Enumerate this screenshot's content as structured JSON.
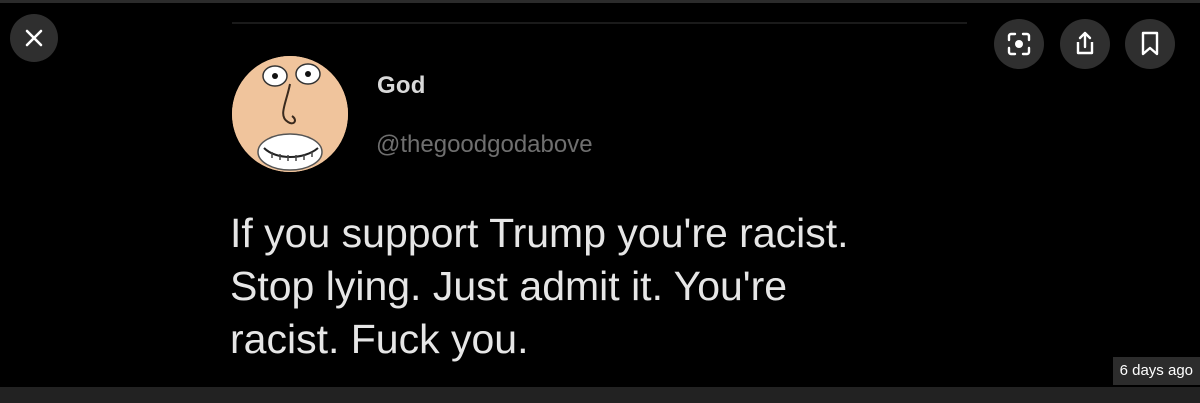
{
  "viewer": {
    "close_icon": "close-icon",
    "actions": [
      {
        "icon": "lens-icon"
      },
      {
        "icon": "share-icon"
      },
      {
        "icon": "bookmark-icon"
      }
    ],
    "timestamp": "6 days ago"
  },
  "tweet": {
    "name": "God",
    "handle": "@thegoodgodabove",
    "text_lines": [
      "If you support Trump you're racist.",
      "Stop lying. Just admit it. You're",
      "racist. Fuck you."
    ]
  },
  "colors": {
    "background": "#000000",
    "button_bg": "#2f2f2f",
    "name_text": "#d9d9d9",
    "handle_text": "#6f6f6f",
    "tweet_text": "#e6e6e6",
    "avatar_skin": "#f0c49c"
  }
}
